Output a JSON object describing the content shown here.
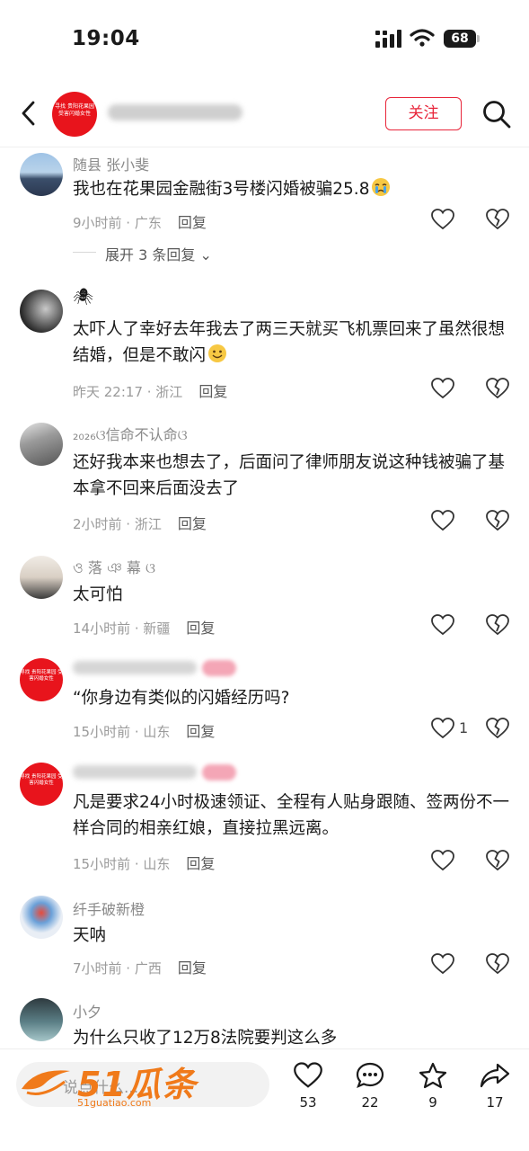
{
  "status_bar": {
    "time": "19:04",
    "battery": "68"
  },
  "header": {
    "avatar_text": "寻找 贵阳花果园 受害闪婚女性",
    "follow_label": "关注"
  },
  "comments": [
    {
      "username": "随县 张小斐",
      "text": "我也在花果园金融街3号楼闪婚被骗25.8",
      "time": "9小时前 · 广东",
      "reply": "回复",
      "likes": ""
    },
    {
      "username": "",
      "text": "太吓人了幸好去年我去了两三天就买飞机票回来了虽然很想结婚，但是不敢闪",
      "time": "昨天 22:17 · 浙江",
      "reply": "回复",
      "likes": ""
    },
    {
      "username": "₂₀₂₆ଓ信命不认命ଓ",
      "text": "还好我本来也想去了，后面问了律师朋友说这种钱被骗了基本拿不回来后面没去了",
      "time": "2小时前 · 浙江",
      "reply": "回复",
      "likes": ""
    },
    {
      "username": "ও 落 ঞ 幕 ଓ",
      "text": "太可怕",
      "time": "14小时前 · 新疆",
      "reply": "回复",
      "likes": ""
    },
    {
      "username": "",
      "text": "“你身边有类似的闪婚经历吗?",
      "time": "15小时前 · 山东",
      "reply": "回复",
      "likes": "1"
    },
    {
      "username": "",
      "text": "凡是要求24小时极速领证、全程有人贴身跟随、签两份不一样合同的相亲红娘，直接拉黑远离。",
      "time": "15小时前 · 山东",
      "reply": "回复",
      "likes": ""
    },
    {
      "username": "纤手破新橙",
      "text": "天呐",
      "time": "7小时前 · 广西",
      "reply": "回复",
      "likes": ""
    },
    {
      "username": "小夕",
      "text": "为什么只收了12万8法院要判这么多",
      "time": "",
      "reply": "",
      "likes": ""
    }
  ],
  "expand_replies": "展开 3 条回复",
  "bottom_bar": {
    "input_placeholder": "说点什么...",
    "watermark_brand": "51瓜条",
    "watermark_url": "51guatiao.com",
    "likes": "53",
    "comments": "22",
    "favorites": "9",
    "shares": "17"
  },
  "colors": {
    "accent": "#e8253a",
    "brand_red": "#e8141c",
    "watermark": "#f07a1a"
  },
  "icons": [
    "back-icon",
    "search-icon",
    "heart-icon",
    "broken-heart-icon",
    "comment-icon",
    "star-icon",
    "share-icon",
    "chevron-down-icon",
    "spider-icon",
    "crying-emoji-icon",
    "smile-emoji-icon"
  ]
}
